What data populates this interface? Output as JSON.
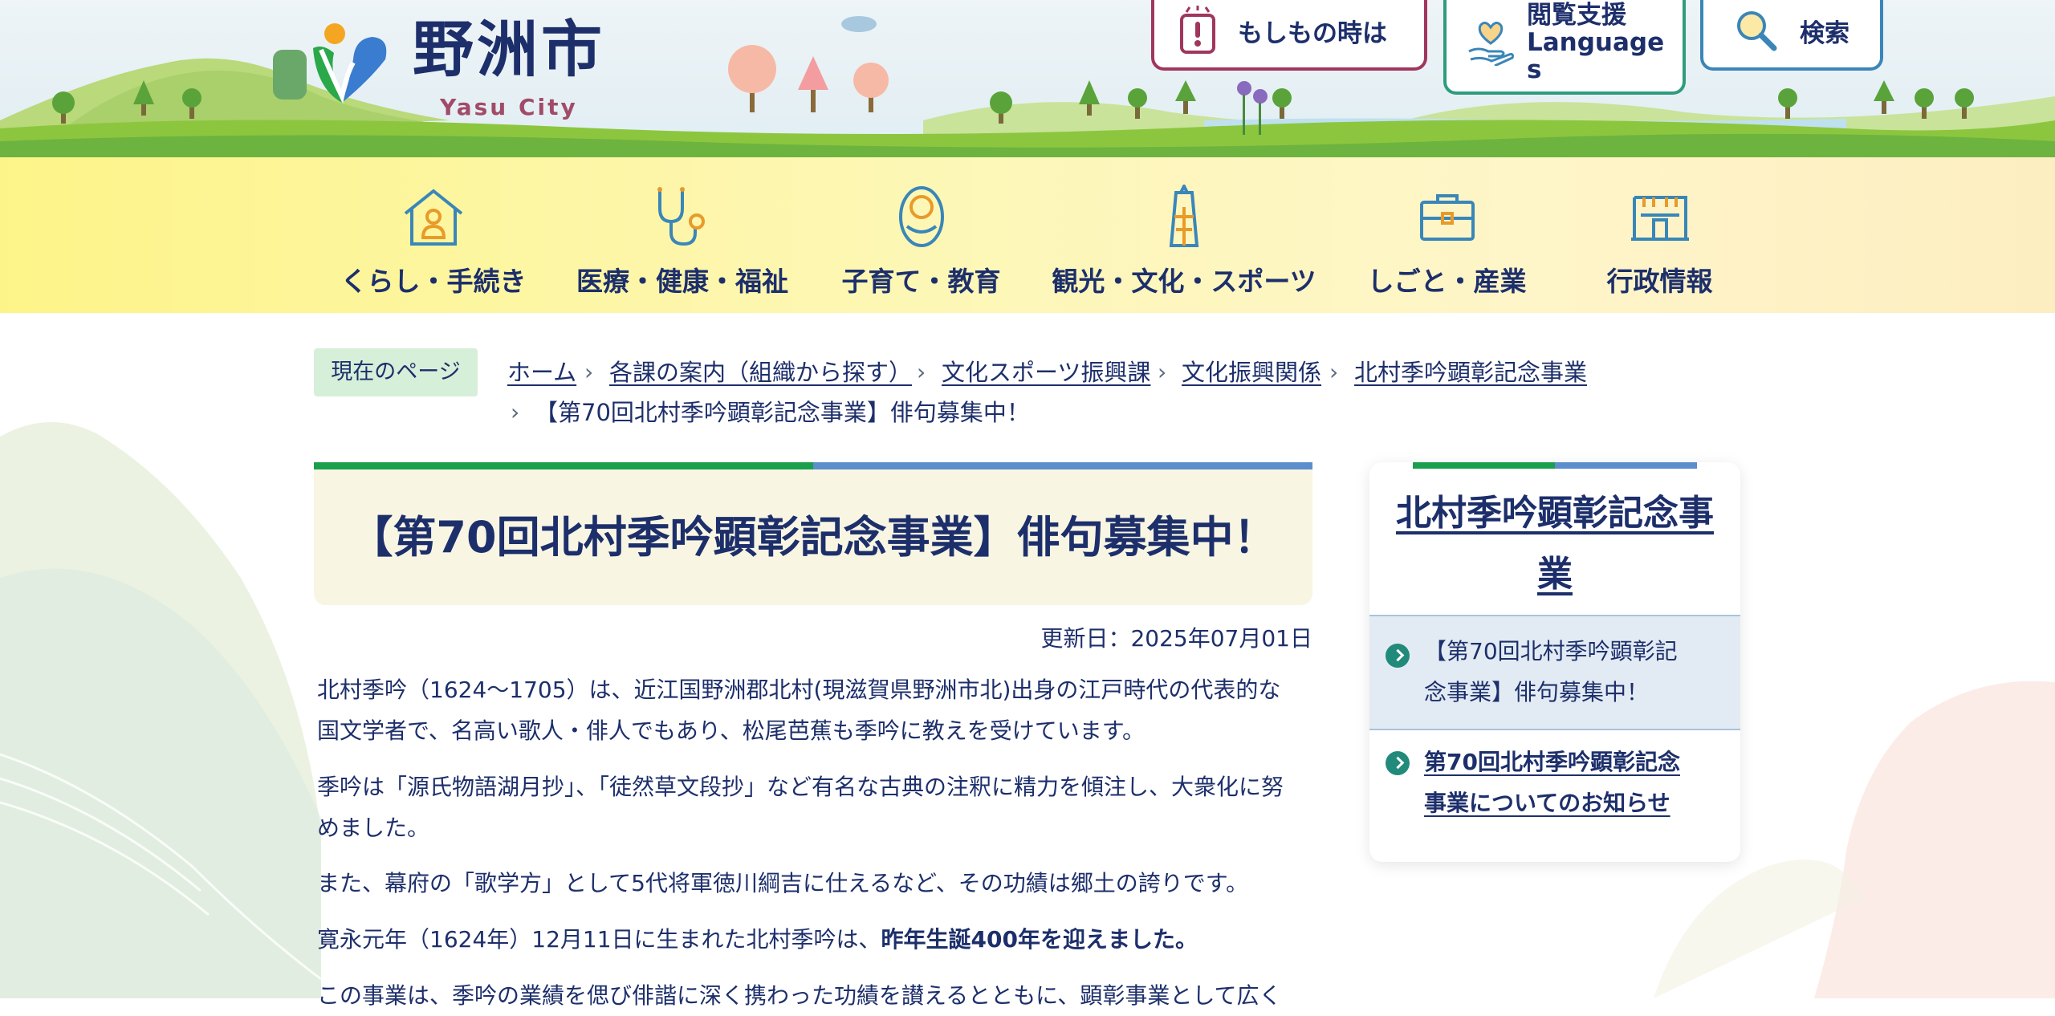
{
  "header": {
    "logo_text": "野洲市",
    "logo_subtext": "Yasu City",
    "emergency_label": "もしもの時は",
    "language_label_line1": "閲覧支援",
    "language_label_line2": "Language",
    "language_label_line3": "s",
    "search_label": "検索"
  },
  "gnav": {
    "items": [
      {
        "label": "くらし・手続き",
        "icon": "house-person-icon"
      },
      {
        "label": "医療・健康・福祉",
        "icon": "stethoscope-icon"
      },
      {
        "label": "子育て・教育",
        "icon": "baby-icon"
      },
      {
        "label": "観光・文化・スポーツ",
        "icon": "tower-icon"
      },
      {
        "label": "しごと・産業",
        "icon": "briefcase-icon"
      },
      {
        "label": "行政情報",
        "icon": "building-icon"
      }
    ]
  },
  "breadcrumb": {
    "tag": "現在のページ",
    "items": [
      "ホーム",
      "各課の案内（組織から探す）",
      "文化スポーツ振興課",
      "文化振興関係",
      "北村季吟顕彰記念事業",
      "【第70回北村季吟顕彰記念事業】俳句募集中！"
    ]
  },
  "article": {
    "title": "【第70回北村季吟顕彰記念事業】俳句募集中！",
    "updated": "更新日：2025年07月01日",
    "paragraphs": {
      "p1_line1": "北村季吟（1624～1705）は、近江国野洲郡北村(現滋賀県野洲市北)出身の江戸時代の代表的な",
      "p1_line2": "国文学者で、名高い歌人・俳人でもあり、松尾芭蕉も季吟に教えを受けています。",
      "p2_line1": "季吟は「源氏物語湖月抄」、「徒然草文段抄」など有名な古典の注釈に精力を傾注し、大衆化に努",
      "p2_line2": "めました。",
      "p3": "また、幕府の「歌学方」として5代将軍徳川綱吉に仕えるなど、その功績は郷土の誇りです。",
      "p4_plain": "寛永元年（1624年）12月11日に生まれた北村季吟は、",
      "p4_bold": "昨年生誕400年を迎えました。",
      "p5": "この事業は、季吟の業績を偲び俳諧に深く携わった功績を讃えるとともに、顕彰事業として広く"
    }
  },
  "side_nav": {
    "title_line1": "北村季吟顕彰記念事",
    "title_line2": "業",
    "items": [
      {
        "line1": "【第70回北村季吟顕彰記",
        "line2": "念事業】俳句募集中！"
      },
      {
        "line1": "第70回北村季吟顕彰記念",
        "line2": "事業についてのお知らせ"
      }
    ]
  },
  "colors": {
    "navy": "#1d2f6b",
    "green_accent": "#1aa04c",
    "blue_accent": "#5c8dcc",
    "emergency_border": "#a0365d",
    "language_border": "#2e9c7d",
    "search_border": "#3a86b8"
  }
}
